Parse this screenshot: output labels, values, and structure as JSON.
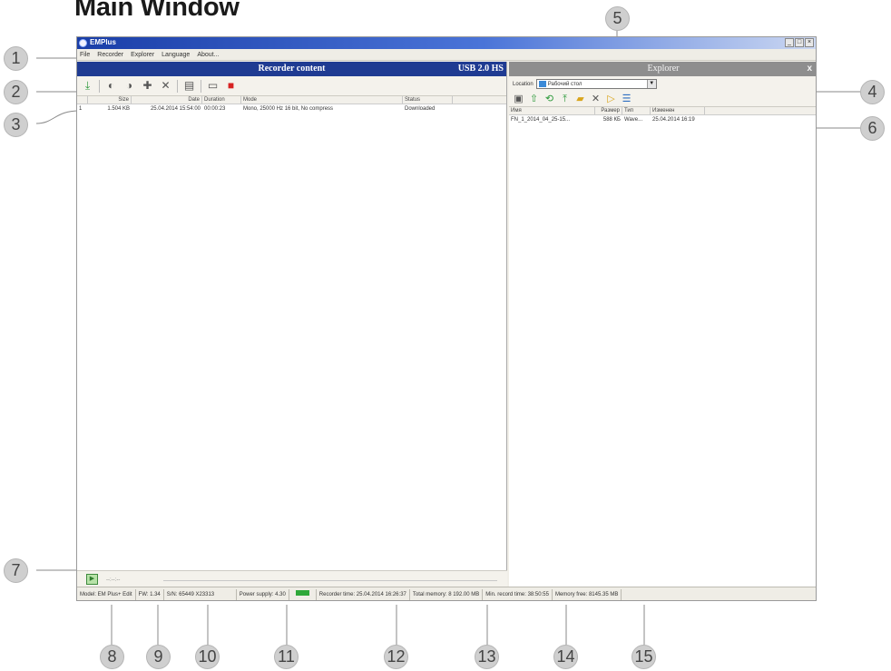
{
  "doc_title": "Main Window",
  "window": {
    "title": "EMPlus",
    "controls": [
      "_",
      "□",
      "×"
    ]
  },
  "menu": [
    "File",
    "Recorder",
    "Explorer",
    "Language",
    "About..."
  ],
  "recorder_pane": {
    "title": "Recorder content",
    "usb_label": "USB 2.0 HS",
    "columns": [
      "",
      "Size",
      "Date",
      "Duration",
      "Mode",
      "Status"
    ],
    "rows": [
      [
        "1",
        "1.504 KB",
        "25.04.2014 15:54:00",
        "00:00:23",
        "Mono, 25000 Hz 16 bit, No compress",
        "Downloaded"
      ]
    ]
  },
  "player": {
    "timeline": "--:--:--"
  },
  "explorer_pane": {
    "title": "Explorer",
    "close_label": "x",
    "location_label": "Location",
    "location_value": "Рабочий стол",
    "columns": [
      "Имя",
      "Размер",
      "Тип",
      "Изменен"
    ],
    "rows": [
      [
        "FN_1_2014_04_25-15...",
        "588 КБ",
        "Wave...",
        "25.04.2014 16:19"
      ]
    ]
  },
  "status": {
    "model": "Model: EM Plus+ Edit",
    "fw": "FW: 1.34",
    "sn": "S/N: 65449 X23313",
    "power": "Power supply: 4.30",
    "recorder_time": "Recorder time: 25.04.2014 16:26:37",
    "total_memory": "Total memory: 8 192.00 MB",
    "min_record_time": "Min. record time: 38:50:55",
    "memory_free": "Memory free: 8145.35 MB"
  },
  "callouts": [
    "1",
    "2",
    "3",
    "4",
    "5",
    "6",
    "7",
    "8",
    "9",
    "10",
    "11",
    "12",
    "13",
    "14",
    "15"
  ],
  "colors": {
    "recorder_header": "#1f3b92",
    "explorer_header": "#8e8e8e",
    "battery": "#2fa83a"
  }
}
